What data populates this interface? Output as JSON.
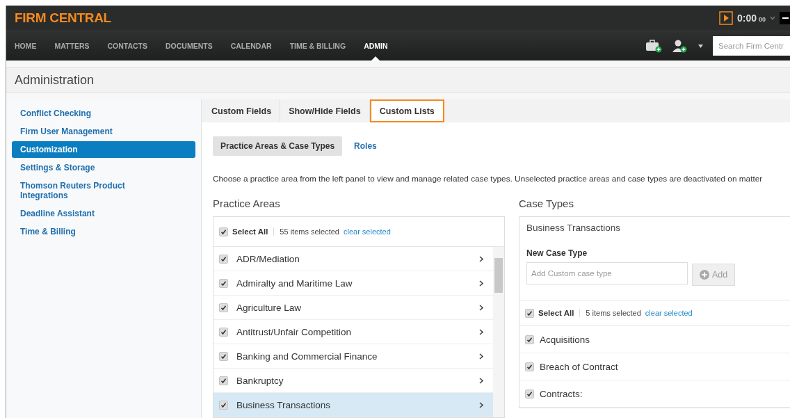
{
  "app": {
    "logo": "FIRM CENTRAL",
    "timer": {
      "time": "0:00",
      "suffix": "00"
    }
  },
  "nav": [
    {
      "label": "HOME",
      "selected": false
    },
    {
      "label": "MATTERS",
      "selected": false
    },
    {
      "label": "CONTACTS",
      "selected": false
    },
    {
      "label": "DOCUMENTS",
      "selected": false
    },
    {
      "label": "CALENDAR",
      "selected": false
    },
    {
      "label": "TIME & BILLING",
      "selected": false
    },
    {
      "label": "ADMIN",
      "selected": true
    }
  ],
  "search": {
    "placeholder": "Search Firm Centr"
  },
  "page_title": "Administration",
  "sidebar": {
    "items": [
      {
        "label": "Conflict Checking",
        "selected": false
      },
      {
        "label": "Firm User Management",
        "selected": false
      },
      {
        "label": "Customization",
        "selected": true
      },
      {
        "label": "Settings & Storage",
        "selected": false
      },
      {
        "label": "Thomson Reuters Product Integrations",
        "selected": false
      },
      {
        "label": "Deadline Assistant",
        "selected": false
      },
      {
        "label": "Time & Billing",
        "selected": false
      }
    ]
  },
  "tabs": [
    {
      "label": "Custom Fields",
      "selected": false
    },
    {
      "label": "Show/Hide Fields",
      "selected": false
    },
    {
      "label": "Custom Lists",
      "selected": true
    }
  ],
  "subtabs": [
    {
      "label": "Practice Areas & Case Types",
      "selected": true
    },
    {
      "label": "Roles",
      "selected": false
    }
  ],
  "description": "Choose a practice area from the left panel to view and manage related case types. Unselected practice areas and case types are deactivated on matter",
  "practice_areas": {
    "title": "Practice Areas",
    "select_all": {
      "label": "Select All",
      "checked": true
    },
    "count": "55 items selected",
    "clear": "clear selected",
    "items": [
      {
        "label": "ADR/Mediation",
        "checked": true,
        "selected": false
      },
      {
        "label": "Admiralty and Maritime Law",
        "checked": true,
        "selected": false
      },
      {
        "label": "Agriculture Law",
        "checked": true,
        "selected": false
      },
      {
        "label": "Antitrust/Unfair Competition",
        "checked": true,
        "selected": false
      },
      {
        "label": "Banking and Commercial Finance",
        "checked": true,
        "selected": false
      },
      {
        "label": "Bankruptcy",
        "checked": true,
        "selected": false
      },
      {
        "label": "Business Transactions",
        "checked": true,
        "selected": true
      }
    ]
  },
  "case_types": {
    "title": "Case Types",
    "practice_area": "Business Transactions",
    "new_label": "New Case Type",
    "placeholder": "Add Custom case type",
    "add_button": "Add",
    "select_all": {
      "label": "Select All",
      "checked": true
    },
    "count": "5 items selected",
    "clear": "clear selected",
    "items": [
      {
        "label": "Acquisitions",
        "checked": true
      },
      {
        "label": "Breach of Contract",
        "checked": true
      },
      {
        "label": "Contracts:",
        "checked": true
      }
    ]
  }
}
